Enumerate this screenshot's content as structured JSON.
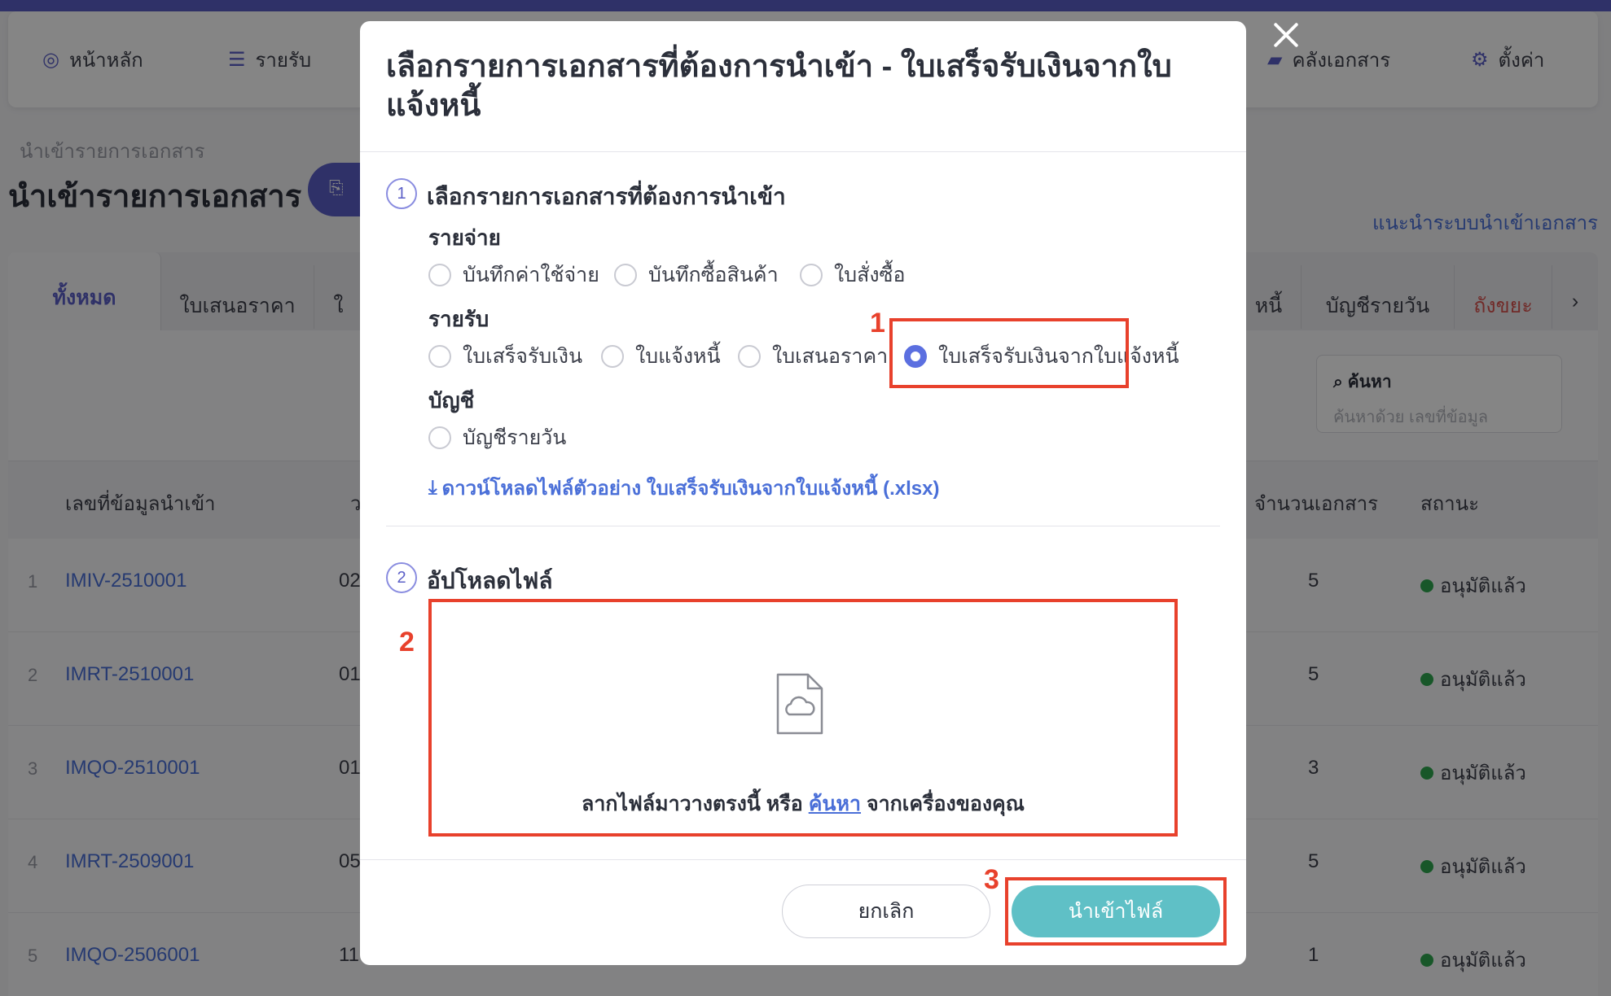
{
  "nav": {
    "items": [
      {
        "label": "หน้าหลัก",
        "icon": "dashboard-icon"
      },
      {
        "label": "รายรับ",
        "icon": "list-icon"
      },
      {
        "label": "คลังเอกสาร",
        "icon": "folder-icon"
      },
      {
        "label": "ตั้งค่า",
        "icon": "gear-icon"
      }
    ]
  },
  "page": {
    "breadcrumb": "นำเข้ารายการเอกสาร",
    "title": "นำเข้ารายการเอกสาร",
    "guide_link": "แนะนำระบบนำเข้าเอกสาร"
  },
  "tabs": [
    {
      "label": "ทั้งหมด",
      "active": true
    },
    {
      "label": "ใบเสนอราคา"
    },
    {
      "label": "ใ"
    },
    {
      "label": "หนี้"
    },
    {
      "label": "บัญชีรายวัน"
    },
    {
      "label": "ถังขยะ"
    }
  ],
  "search": {
    "title": "ค้นหา",
    "placeholder": "ค้นหาด้วย เลขที่ข้อมูล"
  },
  "table": {
    "columns": [
      "เลขที่ข้อมูลนำเข้า",
      "ว",
      "จำนวนเอกสาร",
      "สถานะ"
    ],
    "rows": [
      {
        "num": "1",
        "id": "IMIV-2510001",
        "date": "02",
        "count": "5",
        "status": "อนุมัติแล้ว"
      },
      {
        "num": "2",
        "id": "IMRT-2510001",
        "date": "01",
        "count": "5",
        "status": "อนุมัติแล้ว"
      },
      {
        "num": "3",
        "id": "IMQO-2510001",
        "date": "01",
        "count": "3",
        "status": "อนุมัติแล้ว"
      },
      {
        "num": "4",
        "id": "IMRT-2509001",
        "date": "05",
        "count": "5",
        "status": "อนุมัติแล้ว"
      },
      {
        "num": "5",
        "id": "IMQO-2506001",
        "date": "11",
        "count": "1",
        "status": "อนุมัติแล้ว"
      }
    ]
  },
  "modal": {
    "title": "เลือกรายการเอกสารที่ต้องการนำเข้า - ใบเสร็จรับเงินจากใบแจ้งหนี้",
    "step1": {
      "number": "1",
      "title": "เลือกรายการเอกสารที่ต้องการนำเข้า"
    },
    "groups": {
      "expense": {
        "label": "รายจ่าย",
        "options": [
          "บันทึกค่าใช้จ่าย",
          "บันทึกซื้อสินค้า",
          "ใบสั่งซื้อ"
        ]
      },
      "income": {
        "label": "รายรับ",
        "options": [
          "ใบเสร็จรับเงิน",
          "ใบแจ้งหนี้",
          "ใบเสนอราคา",
          "ใบเสร็จรับเงินจากใบแจ้งหนี้"
        ],
        "selected": "ใบเสร็จรับเงินจากใบแจ้งหนี้"
      },
      "account": {
        "label": "บัญชี",
        "options": [
          "บัญชีรายวัน"
        ]
      }
    },
    "download_link": "ดาวน์โหลดไฟล์ตัวอย่าง ใบเสร็จรับเงินจากใบแจ้งหนี้ (.xlsx)",
    "step2": {
      "number": "2",
      "title": "อัปโหลดไฟล์"
    },
    "dropzone": {
      "text_before": "ลากไฟล์มาวางตรงนี้ หรือ",
      "link": "ค้นหา",
      "text_after": "จากเครื่องของคุณ"
    },
    "cancel_label": "ยกเลิก",
    "import_label": "นำเข้าไฟล์"
  },
  "annotations": [
    "1",
    "2",
    "3"
  ],
  "colors": {
    "accent": "#5b5fc7",
    "highlight": "#e8412c",
    "import_button": "#5fc0c6",
    "status_ok": "#2fa84f"
  }
}
